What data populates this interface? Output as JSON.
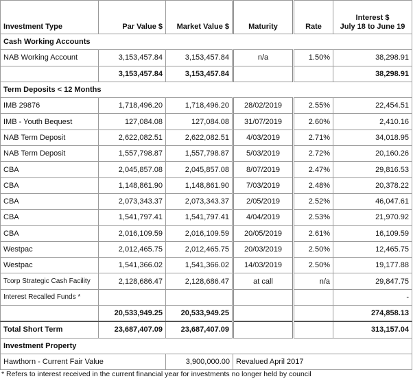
{
  "header": {
    "investment_type": "Investment Type",
    "par_value": "Par Value $",
    "market_value": "Market Value $",
    "maturity": "Maturity",
    "rate": "Rate",
    "interest_line1": "Interest $",
    "interest_line2": "July 18 to June 19"
  },
  "cash": {
    "title": "Cash Working Accounts",
    "rows": [
      {
        "name": "NAB Working Account",
        "par": "3,153,457.84",
        "market": "3,153,457.84",
        "maturity": "n/a",
        "rate": "1.50%",
        "interest": "38,298.91"
      }
    ],
    "subtotal": {
      "par": "3,153,457.84",
      "market": "3,153,457.84",
      "interest": "38,298.91"
    }
  },
  "term": {
    "title": "Term Deposits < 12 Months",
    "rows": [
      {
        "name": "IMB 29876",
        "par": "1,718,496.20",
        "market": "1,718,496.20",
        "maturity": "28/02/2019",
        "rate": "2.55%",
        "interest": "22,454.51"
      },
      {
        "name": "IMB - Youth Bequest",
        "par": "127,084.08",
        "market": "127,084.08",
        "maturity": "31/07/2019",
        "rate": "2.60%",
        "interest": "2,410.16"
      },
      {
        "name": "NAB Term Deposit",
        "par": "2,622,082.51",
        "market": "2,622,082.51",
        "maturity": "4/03/2019",
        "rate": "2.71%",
        "interest": "34,018.95"
      },
      {
        "name": "NAB Term Deposit",
        "par": "1,557,798.87",
        "market": "1,557,798.87",
        "maturity": "5/03/2019",
        "rate": "2.72%",
        "interest": "20,160.26"
      },
      {
        "name": "CBA",
        "par": "2,045,857.08",
        "market": "2,045,857.08",
        "maturity": "8/07/2019",
        "rate": "2.47%",
        "interest": "29,816.53"
      },
      {
        "name": "CBA",
        "par": "1,148,861.90",
        "market": "1,148,861.90",
        "maturity": "7/03/2019",
        "rate": "2.48%",
        "interest": "20,378.22"
      },
      {
        "name": "CBA",
        "par": "2,073,343.37",
        "market": "2,073,343.37",
        "maturity": "2/05/2019",
        "rate": "2.52%",
        "interest": "46,047.61"
      },
      {
        "name": "CBA",
        "par": "1,541,797.41",
        "market": "1,541,797.41",
        "maturity": "4/04/2019",
        "rate": "2.53%",
        "interest": "21,970.92"
      },
      {
        "name": "CBA",
        "par": "2,016,109.59",
        "market": "2,016,109.59",
        "maturity": "20/05/2019",
        "rate": "2.61%",
        "interest": "16,109.59"
      },
      {
        "name": "Westpac",
        "par": "2,012,465.75",
        "market": "2,012,465.75",
        "maturity": "20/03/2019",
        "rate": "2.50%",
        "interest": "12,465.75"
      },
      {
        "name": "Westpac",
        "par": "1,541,366.02",
        "market": "1,541,366.02",
        "maturity": "14/03/2019",
        "rate": "2.50%",
        "interest": "19,177.88"
      },
      {
        "name": "Tcorp Strategic Cash Facility",
        "par": "2,128,686.47",
        "market": "2,128,686.47",
        "maturity": "at call",
        "rate": "n/a",
        "interest": "29,847.75"
      },
      {
        "name": "Interest Recalled Funds *",
        "par": "",
        "market": "",
        "maturity": "",
        "rate": "",
        "interest": "-"
      }
    ],
    "subtotal": {
      "par": "20,533,949.25",
      "market": "20,533,949.25",
      "interest": "274,858.13"
    }
  },
  "total_short_term": {
    "label": "Total Short Term",
    "par": "23,687,407.09",
    "market": "23,687,407.09",
    "interest": "313,157.04"
  },
  "property": {
    "title": "Investment Property",
    "name": "Hawthorn - Current Fair Value",
    "market": "3,900,000.00",
    "note": "Revalued April 2017"
  },
  "footnote": "* Refers to interest received in the current financial year for investments no longer held by council"
}
